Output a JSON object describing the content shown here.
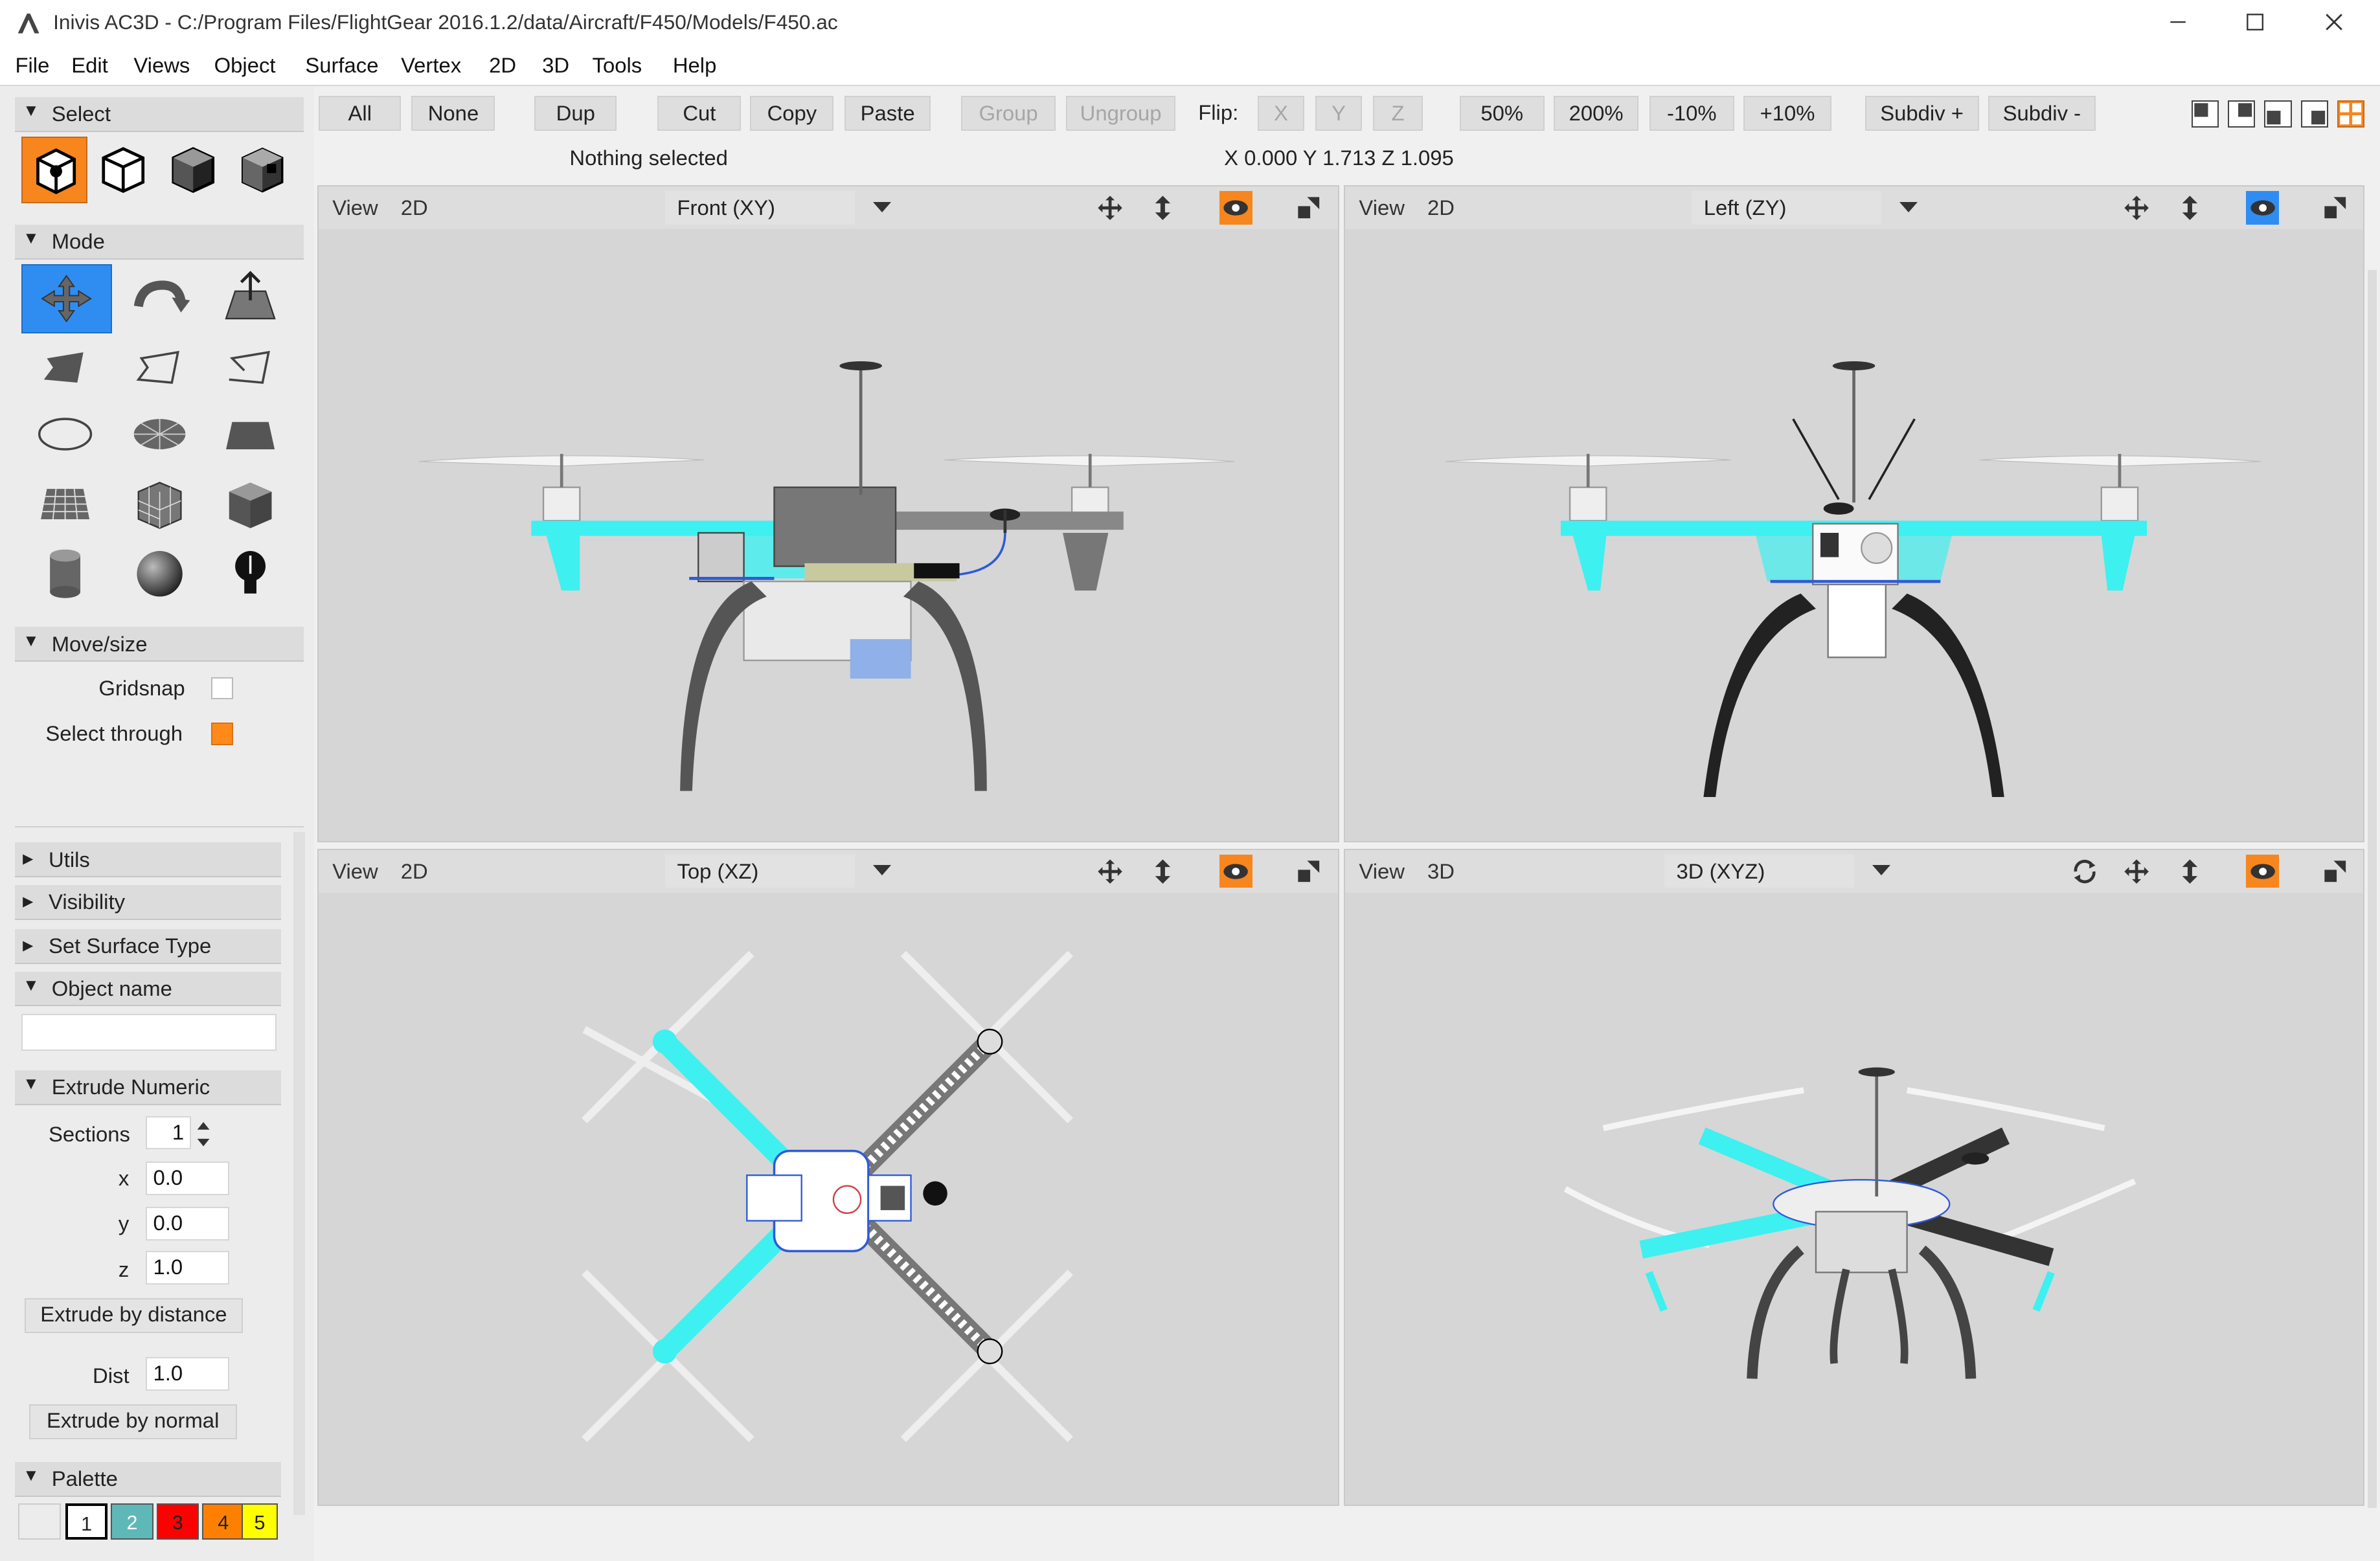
{
  "window": {
    "title": "Inivis AC3D - C:/Program Files/FlightGear 2016.1.2/data/Aircraft/F450/Models/F450.ac"
  },
  "menu": [
    "File",
    "Edit",
    "Views",
    "Object",
    "Surface",
    "Vertex",
    "2D",
    "3D",
    "Tools",
    "Help"
  ],
  "left": {
    "select_header": "Select",
    "mode_header": "Mode",
    "movesize_header": "Move/size",
    "gridsnap": "Gridsnap",
    "select_through": "Select through",
    "collapsed": [
      "Utils",
      "Visibility",
      "Set Surface Type"
    ],
    "object_name_header": "Object name",
    "object_name_value": "",
    "extrude_header": "Extrude Numeric",
    "sections_label": "Sections",
    "sections_value": "1",
    "x_label": "x",
    "x_value": "0.0",
    "y_label": "y",
    "y_value": "0.0",
    "z_label": "z",
    "z_value": "1.0",
    "extrude_distance": "Extrude by distance",
    "dist_label": "Dist",
    "dist_value": "1.0",
    "extrude_normal": "Extrude by normal",
    "palette_header": "Palette",
    "palette": [
      {
        "label": "",
        "color": "#ffffff"
      },
      {
        "label": "1",
        "color": "#ffffff"
      },
      {
        "label": "2",
        "color": "#5fb8b8"
      },
      {
        "label": "3",
        "color": "#ff0000"
      },
      {
        "label": "4",
        "color": "#ff8000"
      },
      {
        "label": "5",
        "color": "#ffff00"
      }
    ]
  },
  "toolbar": {
    "all": "All",
    "none": "None",
    "dup": "Dup",
    "cut": "Cut",
    "copy": "Copy",
    "paste": "Paste",
    "group": "Group",
    "ungroup": "Ungroup",
    "flip": "Flip:",
    "fx": "X",
    "fy": "Y",
    "fz": "Z",
    "p50": "50%",
    "p200": "200%",
    "m10": "-10%",
    "p10": "+10%",
    "subdiv_plus": "Subdiv +",
    "subdiv_minus": "Subdiv -"
  },
  "status": {
    "selection": "Nothing selected",
    "coords": "X 0.000 Y 1.713 Z 1.095"
  },
  "views": [
    {
      "view": "View",
      "mode": "2D",
      "projection": "Front (XY)"
    },
    {
      "view": "View",
      "mode": "2D",
      "projection": "Left (ZY)"
    },
    {
      "view": "View",
      "mode": "2D",
      "projection": "Top (XZ)"
    },
    {
      "view": "View",
      "mode": "3D",
      "projection": "3D (XYZ)"
    }
  ],
  "colors": {
    "accent_orange": "#f7861f",
    "accent_blue": "#2f8df2",
    "frame_cyan": "#3ef0f0"
  }
}
